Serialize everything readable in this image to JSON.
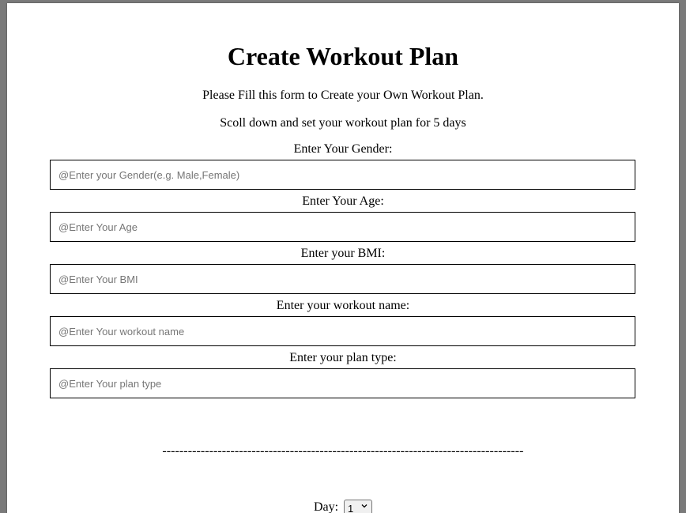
{
  "form": {
    "title": "Create Workout Plan",
    "intro": "Please Fill this form to Create your Own Workout Plan.",
    "instruction": "Scoll down and set your workout plan for 5 days",
    "fields": [
      {
        "label": "Enter Your Gender:",
        "placeholder": "@Enter your Gender(e.g. Male,Female)",
        "value": ""
      },
      {
        "label": "Enter Your Age:",
        "placeholder": "@Enter Your Age",
        "value": ""
      },
      {
        "label": "Enter your BMI:",
        "placeholder": "@Enter Your BMI",
        "value": ""
      },
      {
        "label": "Enter your workout name:",
        "placeholder": "@Enter Your workout name",
        "value": ""
      },
      {
        "label": "Enter your plan type:",
        "placeholder": "@Enter Your plan type",
        "value": ""
      }
    ],
    "divider": "-------------------------------------------------------------------------------------",
    "day": {
      "label": "Day:",
      "selected": "1"
    }
  },
  "icons": {
    "select_chevron": "chevron-down-icon"
  }
}
